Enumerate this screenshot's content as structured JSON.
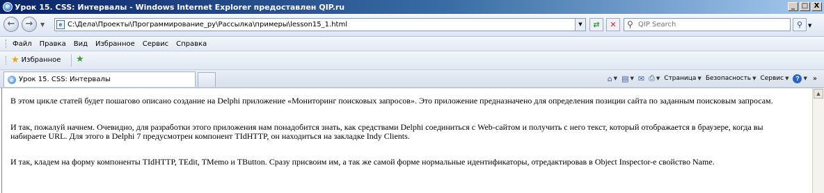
{
  "window": {
    "title": "Урок 15. CSS: Интервалы - Windows Internet Explorer предоставлен QIP.ru",
    "app_icon": "ie-logo-icon",
    "minimize": "_",
    "maximize": "□",
    "close": "X"
  },
  "address_bar": {
    "url": "C:\\Дела\\Проекты\\Программирование_ру\\Рассылка\\примеры\\lesson15_1.html",
    "search_placeholder": "QIP Search",
    "refresh_icon": "refresh-icon",
    "stop_icon": "stop-icon",
    "search_icon": "search-icon"
  },
  "menu": {
    "items": [
      "Файл",
      "Правка",
      "Вид",
      "Избранное",
      "Сервис",
      "Справка"
    ]
  },
  "favorites_bar": {
    "favorites_label": "Избранное"
  },
  "tabs": {
    "active_tab_label": "Урок 15. CSS: Интервалы"
  },
  "command_bar": {
    "page": "Страница",
    "safety": "Безопасность",
    "tools": "Сервис",
    "more": "»"
  },
  "content": {
    "paragraphs": [
      "В этом цикле статей будет пошагово описано создание на Delphi приложение «Мониторинг поисковых запросов». Это приложение предназначено для определения позиции сайта по заданным поисковым запросам.",
      "И так, пожалуй начнем. Очевидно, для разработки этого приложения нам понадобится знать, как средствами Delphi соединиться с Web-сайтом и получить с него текст, который отображается в браузере, когда вы набираете URL. Для этого в Delphi 7 предусмотрен компонент TIdHTTP, он находиться на закладке Indy Clients.",
      "И так, кладем на форму компоненты TIdHTTP, TEdit, TMemo и TButton. Сразу присвоим им, а так же самой форме нормальные идентификаторы, отредактировав в Object Inspector-е свойство Name."
    ]
  }
}
